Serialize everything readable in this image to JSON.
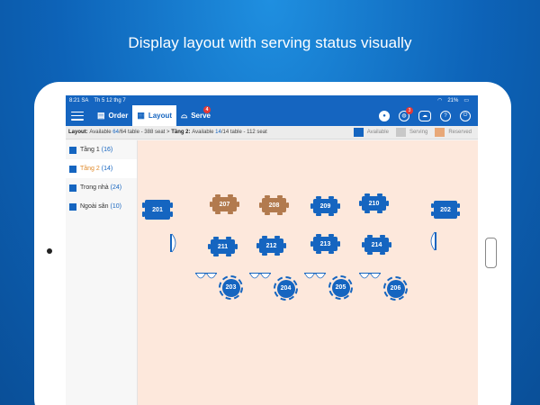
{
  "headline": "Display layout with serving status visually",
  "status_bar": {
    "time": "8:21 SA",
    "date": "Th 5 12 thg 7",
    "battery": "21%"
  },
  "appbar": {
    "order_label": "Order",
    "layout_label": "Layout",
    "serve_label": "Serve",
    "serve_badge": "4",
    "globe_badge": "3",
    "help_glyph": "?"
  },
  "infobar": {
    "layout_prefix": "Layout:",
    "available_word": "Available",
    "layout_available": "64",
    "layout_total": "/64",
    "layout_rest": "table - 388 seat >",
    "floor_name": "Tầng 2:",
    "floor_available": "14",
    "floor_total": "/14",
    "floor_rest": "table - 112 seat"
  },
  "legend": [
    {
      "label": "Available",
      "color": "#1565c0"
    },
    {
      "label": "Serving",
      "color": "#c8c8c8"
    },
    {
      "label": "Reserved",
      "color": "#e8a878"
    }
  ],
  "floors": [
    {
      "name": "Tầng 1",
      "count": "(16)"
    },
    {
      "name": "Tầng 2",
      "count": "(14)"
    },
    {
      "name": "Trong nhà",
      "count": "(24)"
    },
    {
      "name": "Ngoài sân",
      "count": "(10)"
    }
  ],
  "tables": {
    "t201": "201",
    "t202": "202",
    "t207": "207",
    "t208": "208",
    "t209": "209",
    "t210": "210",
    "t211": "211",
    "t212": "212",
    "t213": "213",
    "t214": "214",
    "t203": "203",
    "t204": "204",
    "t205": "205",
    "t206": "206"
  },
  "colors": {
    "brand": "#1565c0",
    "reserved": "#b27a4e",
    "canvas": "#fde8dc",
    "badge": "#e53935"
  }
}
